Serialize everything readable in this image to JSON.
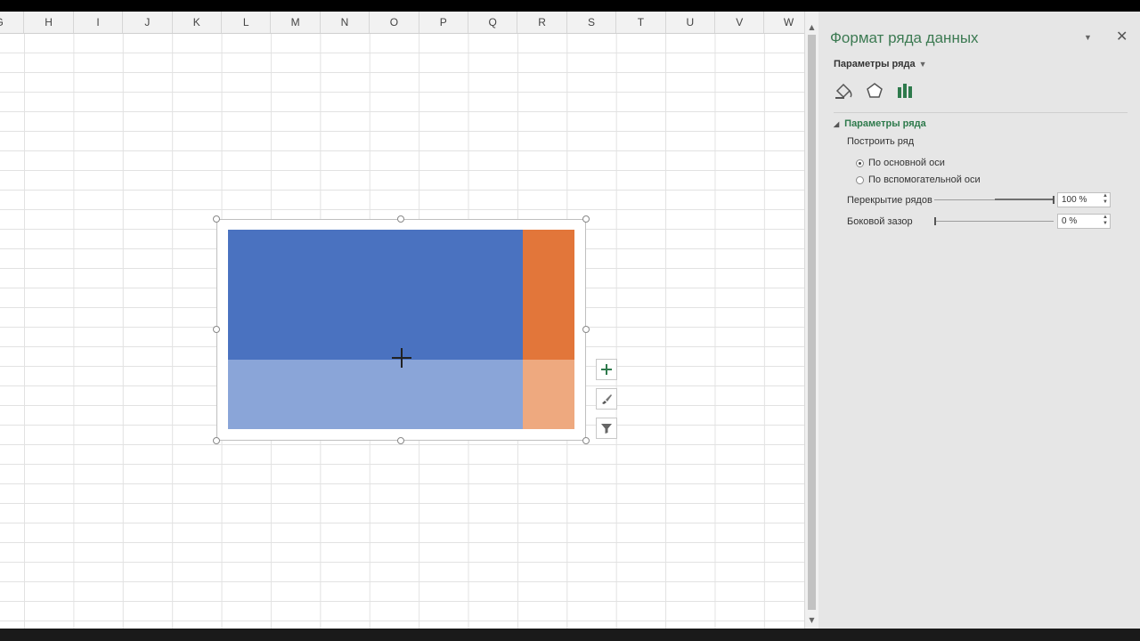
{
  "sheet": {
    "columns": [
      "G",
      "H",
      "I",
      "J",
      "K",
      "L",
      "M",
      "N",
      "O",
      "P",
      "Q",
      "R",
      "S",
      "T",
      "U",
      "V",
      "W"
    ]
  },
  "chart": {
    "colors": {
      "series1": "#4a72c0",
      "series1_light": "#8aa5d8",
      "series2": "#e2763a",
      "series2_light": "#eea97f"
    }
  },
  "chart_buttons": {
    "add_icon": "plus-icon",
    "style_icon": "brush-icon",
    "filter_icon": "funnel-icon"
  },
  "pane": {
    "title": "Формат ряда данных",
    "options_dropdown": "Параметры ряда",
    "tabs": [
      "fill-line-icon",
      "effects-icon",
      "series-options-icon"
    ],
    "section_title": "Параметры ряда",
    "plot_series_label": "Построить ряд",
    "radio_primary": "По основной оси",
    "radio_secondary": "По вспомогательной оси",
    "overlap_label": "Перекрытие рядов",
    "overlap_value": "100 %",
    "overlap_fraction": 1.0,
    "gap_label": "Боковой зазор",
    "gap_value": "0 %",
    "gap_fraction": 0.0,
    "accent_color": "#3c7a52"
  }
}
